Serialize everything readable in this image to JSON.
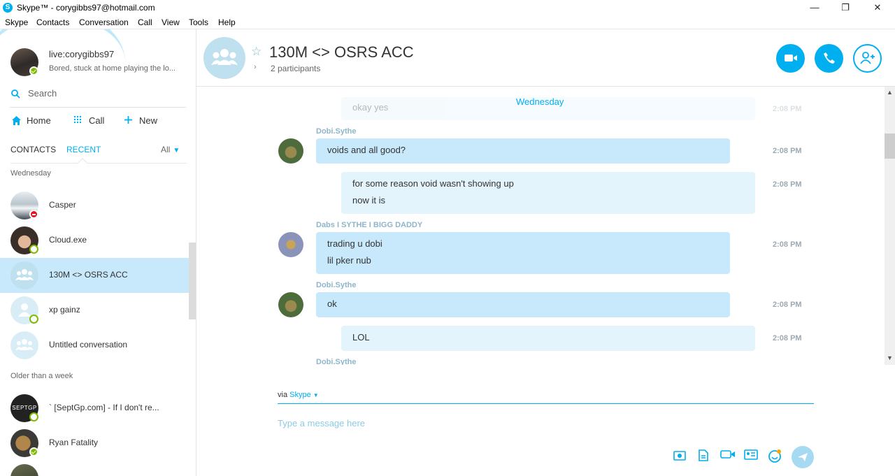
{
  "window": {
    "title": "Skype™ - corygibbs97@hotmail.com",
    "minimize": "—",
    "maximize": "❐",
    "close": "✕"
  },
  "menu": [
    "Skype",
    "Contacts",
    "Conversation",
    "Call",
    "View",
    "Tools",
    "Help"
  ],
  "profile": {
    "name": "live:corygibbs97",
    "mood": "Bored, stuck at home playing the lo..."
  },
  "search": {
    "label": "Search"
  },
  "nav": {
    "home": "Home",
    "call": "Call",
    "new": "New"
  },
  "tabs": {
    "contacts": "CONTACTS",
    "recent": "RECENT",
    "filter": "All"
  },
  "sections": {
    "recent": "Wednesday",
    "older": "Older than a week"
  },
  "contacts_recent": [
    {
      "name": "Casper",
      "status": "dnd"
    },
    {
      "name": "Cloud.exe",
      "status": "ring"
    },
    {
      "name": "130M <> OSRS ACC",
      "status": "group",
      "active": true
    },
    {
      "name": "xp gainz",
      "status": "ring"
    },
    {
      "name": "Untitled conversation",
      "status": "group"
    }
  ],
  "contacts_older": [
    {
      "name": "` [SeptGp.com] - If I don't re...",
      "status": "ring",
      "avatar_text": "SEPTGP"
    },
    {
      "name": "Ryan Fatality",
      "status": "online"
    }
  ],
  "conversation": {
    "title": "130M <> OSRS ACC",
    "participants": "2 participants",
    "date_separator": "Wednesday"
  },
  "messages": [
    {
      "sender": "",
      "lines": [
        "okay yes"
      ],
      "time": "2:08 PM",
      "self": true,
      "faded": true
    },
    {
      "sender": "Dobi.Sythe",
      "lines": [
        "voids and all good?"
      ],
      "time": "2:08 PM",
      "self": false
    },
    {
      "sender": "",
      "lines": [
        "for some reason void wasn't showing up",
        "now it is"
      ],
      "time": "2:08 PM",
      "self": true
    },
    {
      "sender": "Dabs I SYTHE I BIGG DADDY",
      "lines": [
        "trading u dobi",
        "lil pker nub"
      ],
      "time": "2:08 PM",
      "self": false
    },
    {
      "sender": "Dobi.Sythe",
      "lines": [
        "ok"
      ],
      "time": "2:08 PM",
      "self": false
    },
    {
      "sender": "",
      "lines": [
        "LOL"
      ],
      "time": "2:08 PM",
      "self": true
    },
    {
      "sender": "Dobi.Sythe",
      "lines": [],
      "time": "",
      "self": false
    }
  ],
  "composer": {
    "via_prefix": "via",
    "via_service": "Skype",
    "placeholder": "Type a message here"
  },
  "colors": {
    "accent": "#00aff0",
    "bubble": "#c7e9fb",
    "bubble_self": "#e3f4fc",
    "active_row": "#c7e9fb"
  }
}
